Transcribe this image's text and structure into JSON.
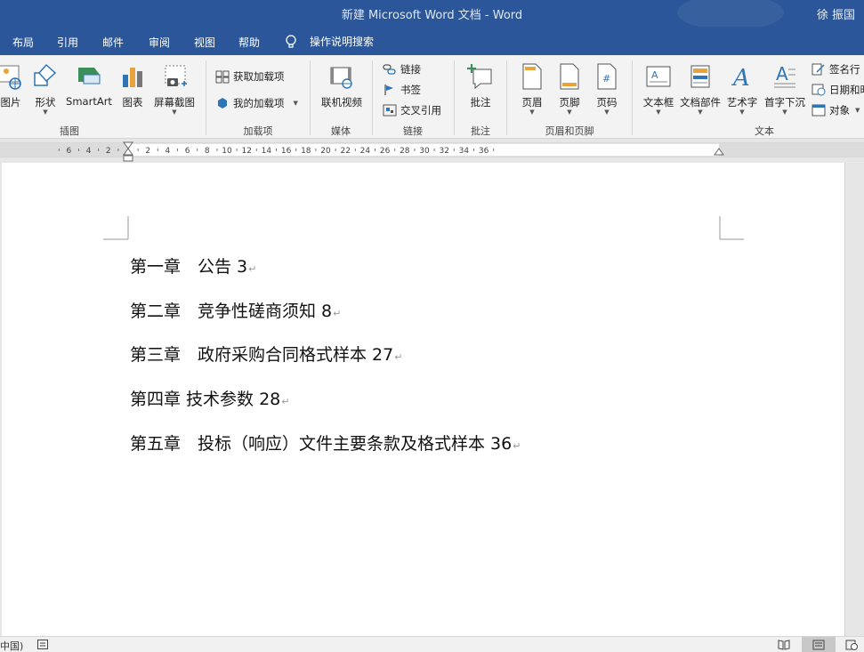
{
  "app": {
    "title": "新建 Microsoft Word 文档  -  Word",
    "user": "徐 振国"
  },
  "tabs": [
    "布局",
    "引用",
    "邮件",
    "审阅",
    "视图",
    "帮助"
  ],
  "tell_me": "操作说明搜索",
  "ribbon": {
    "illustrations": {
      "picture": "图片",
      "shapes": "形状",
      "smartart": "SmartArt",
      "chart": "图表",
      "screenshot": "屏幕截图",
      "group": "插图"
    },
    "addins": {
      "get": "获取加载项",
      "my": "我的加载项",
      "group": "加载项"
    },
    "media": {
      "online_video": "联机视频",
      "group": "媒体"
    },
    "links": {
      "link": "链接",
      "bookmark": "书签",
      "crossref": "交叉引用",
      "group": "链接"
    },
    "comments": {
      "comment": "批注",
      "group": "批注"
    },
    "header_footer": {
      "header": "页眉",
      "footer": "页脚",
      "page_number": "页码",
      "group": "页眉和页脚"
    },
    "text": {
      "textbox": "文本框",
      "quickparts": "文档部件",
      "wordart": "艺术字",
      "dropcap": "首字下沉",
      "signature": "签名行",
      "datetime": "日期和时",
      "object": "对象",
      "group": "文本"
    }
  },
  "ruler": {
    "labels": [
      "6",
      "4",
      "2",
      "2",
      "4",
      "6",
      "8",
      "10",
      "12",
      "14",
      "16",
      "18",
      "20",
      "22",
      "24",
      "26",
      "28",
      "30",
      "32",
      "34",
      "36"
    ]
  },
  "document": {
    "lines": [
      "第一章　公告 3",
      "第二章　竞争性磋商须知 8",
      "第三章　政府采购合同格式样本 27",
      "第四章 技术参数 28",
      "第五章　投标（响应）文件主要条款及格式样本 36"
    ],
    "para_mark": "↵"
  },
  "status": {
    "language": "中国)"
  },
  "colors": {
    "titlebar": "#2b579a",
    "ribbon": "#f3f3f3",
    "page": "#ffffff"
  }
}
